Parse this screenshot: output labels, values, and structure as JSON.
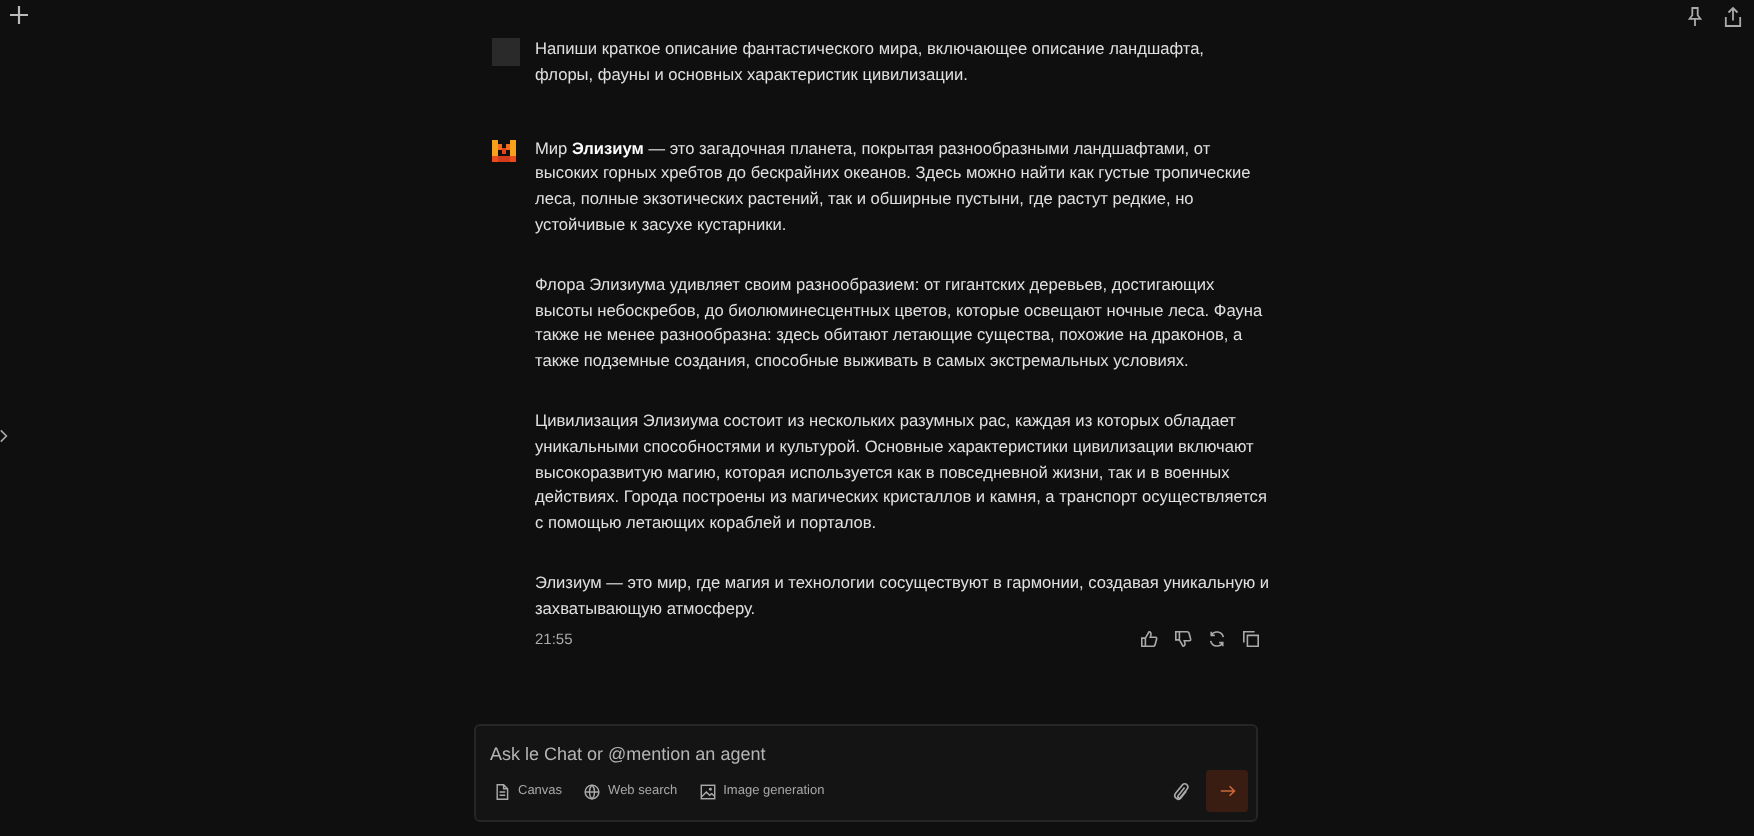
{
  "user_message": {
    "text": "Напиши краткое описание фантастического мира, включающее описание ландшафта, флоры, фауны и основных характеристик цивилизации."
  },
  "assistant_message": {
    "paragraphs": [
      "Мир **Элизиум** — это загадочная планета, покрытая разнообразными ландшафтами, от высоких горных хребтов до бескрайних океанов. Здесь можно найти как густые тропические леса, полные экзотических растений, так и обширные пустыни, где растут редкие, но устойчивые к засухе кустарники.",
      "Флора Элизиума удивляет своим разнообразием: от гигантских деревьев, достигающих высоты небоскребов, до биолюминесцентных цветов, которые освещают ночные леса. Фауна также не менее разнообразна: здесь обитают летающие существа, похожие на драконов, а также подземные создания, способные выживать в самых экстремальных условиях.",
      "Цивилизация Элизиума состоит из нескольких разумных рас, каждая из которых обладает уникальными способностями и культурой. Основные характеристики цивилизации включают высокоразвитую магию, которая используется как в повседневной жизни, так и в военных действиях. Города построены из магических кристаллов и камня, а транспорт осуществляется с помощью летающих кораблей и порталов.",
      "Элизиум — это мир, где магия и технологии сосуществуют в гармонии, создавая уникальную и захватывающую атмосферу."
    ],
    "time": "21:55"
  },
  "composer": {
    "placeholder": "Ask le Chat or @mention an agent",
    "tools": [
      {
        "kind": "canvas",
        "label": "Canvas"
      },
      {
        "kind": "web",
        "label": "Web search"
      },
      {
        "kind": "image",
        "label": "Image generation"
      }
    ]
  }
}
